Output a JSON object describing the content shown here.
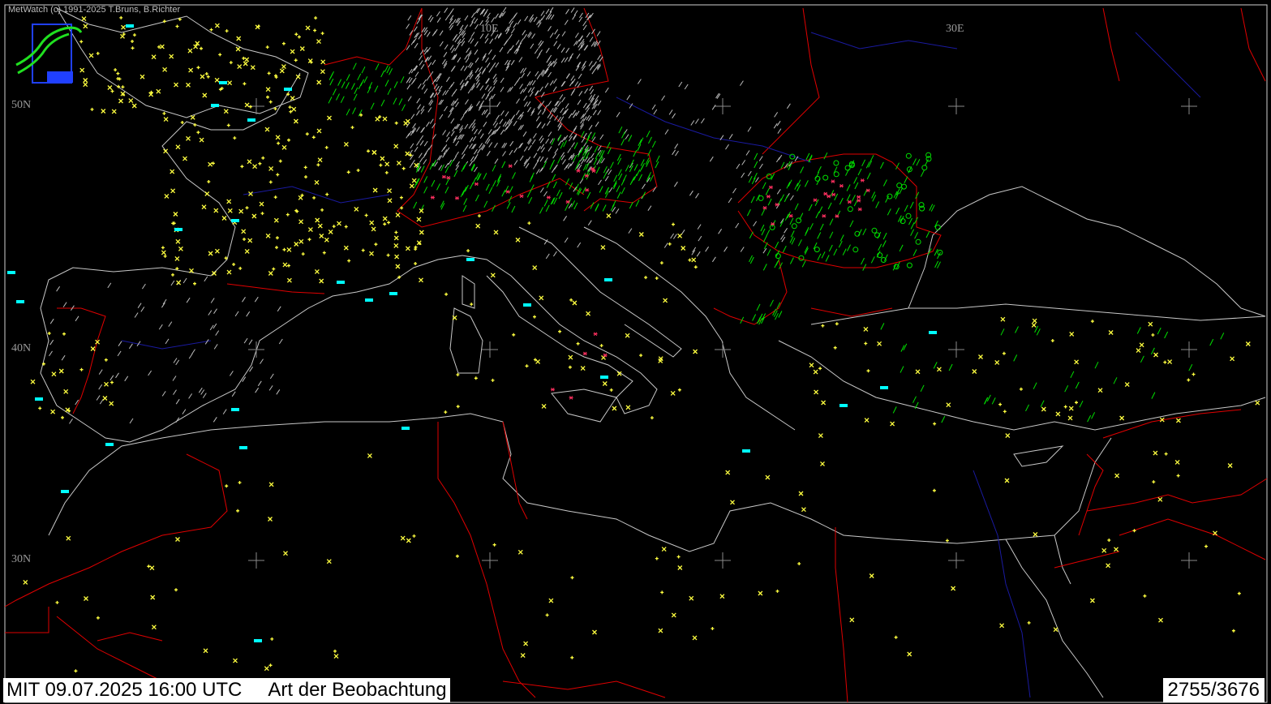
{
  "app": {
    "copyright": "MetWatch  (c) 1991-2025 T.Bruns, B.Richter",
    "logo_icon": "metwatch-logo-icon"
  },
  "grid": {
    "lat_labels": [
      "50N",
      "40N",
      "30N"
    ],
    "lon_labels": [
      "10E",
      "30E"
    ]
  },
  "status": {
    "datetime": "MIT 09.07.2025 16:00 UTC",
    "parameter": "Art der Beobachtung",
    "count": "2755/3676"
  },
  "colors": {
    "background": "#000000",
    "coastline": "#c8c8c8",
    "borders": "#e00000",
    "rivers": "#1a1aa0",
    "drizzle": "#ffff40",
    "rain": "#00e000",
    "snow_rain": "#ff3060",
    "shower": "#00ffff",
    "cloud": "#bdbdbd"
  },
  "symbols": [
    "x-mark",
    "plus-mark",
    "slash-mark",
    "circle-mark",
    "ship-icon",
    "asterisk-mark"
  ]
}
